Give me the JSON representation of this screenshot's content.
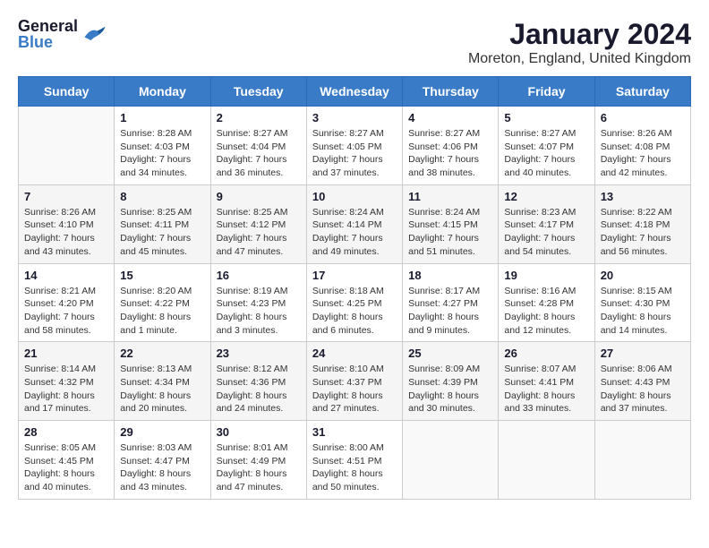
{
  "header": {
    "logo": {
      "general": "General",
      "blue": "Blue"
    },
    "title": "January 2024",
    "location": "Moreton, England, United Kingdom"
  },
  "calendar": {
    "days_of_week": [
      "Sunday",
      "Monday",
      "Tuesday",
      "Wednesday",
      "Thursday",
      "Friday",
      "Saturday"
    ],
    "weeks": [
      [
        {
          "date": "",
          "info": ""
        },
        {
          "date": "1",
          "info": "Sunrise: 8:28 AM\nSunset: 4:03 PM\nDaylight: 7 hours\nand 34 minutes."
        },
        {
          "date": "2",
          "info": "Sunrise: 8:27 AM\nSunset: 4:04 PM\nDaylight: 7 hours\nand 36 minutes."
        },
        {
          "date": "3",
          "info": "Sunrise: 8:27 AM\nSunset: 4:05 PM\nDaylight: 7 hours\nand 37 minutes."
        },
        {
          "date": "4",
          "info": "Sunrise: 8:27 AM\nSunset: 4:06 PM\nDaylight: 7 hours\nand 38 minutes."
        },
        {
          "date": "5",
          "info": "Sunrise: 8:27 AM\nSunset: 4:07 PM\nDaylight: 7 hours\nand 40 minutes."
        },
        {
          "date": "6",
          "info": "Sunrise: 8:26 AM\nSunset: 4:08 PM\nDaylight: 7 hours\nand 42 minutes."
        }
      ],
      [
        {
          "date": "7",
          "info": "Sunrise: 8:26 AM\nSunset: 4:10 PM\nDaylight: 7 hours\nand 43 minutes."
        },
        {
          "date": "8",
          "info": "Sunrise: 8:25 AM\nSunset: 4:11 PM\nDaylight: 7 hours\nand 45 minutes."
        },
        {
          "date": "9",
          "info": "Sunrise: 8:25 AM\nSunset: 4:12 PM\nDaylight: 7 hours\nand 47 minutes."
        },
        {
          "date": "10",
          "info": "Sunrise: 8:24 AM\nSunset: 4:14 PM\nDaylight: 7 hours\nand 49 minutes."
        },
        {
          "date": "11",
          "info": "Sunrise: 8:24 AM\nSunset: 4:15 PM\nDaylight: 7 hours\nand 51 minutes."
        },
        {
          "date": "12",
          "info": "Sunrise: 8:23 AM\nSunset: 4:17 PM\nDaylight: 7 hours\nand 54 minutes."
        },
        {
          "date": "13",
          "info": "Sunrise: 8:22 AM\nSunset: 4:18 PM\nDaylight: 7 hours\nand 56 minutes."
        }
      ],
      [
        {
          "date": "14",
          "info": "Sunrise: 8:21 AM\nSunset: 4:20 PM\nDaylight: 7 hours\nand 58 minutes."
        },
        {
          "date": "15",
          "info": "Sunrise: 8:20 AM\nSunset: 4:22 PM\nDaylight: 8 hours\nand 1 minute."
        },
        {
          "date": "16",
          "info": "Sunrise: 8:19 AM\nSunset: 4:23 PM\nDaylight: 8 hours\nand 3 minutes."
        },
        {
          "date": "17",
          "info": "Sunrise: 8:18 AM\nSunset: 4:25 PM\nDaylight: 8 hours\nand 6 minutes."
        },
        {
          "date": "18",
          "info": "Sunrise: 8:17 AM\nSunset: 4:27 PM\nDaylight: 8 hours\nand 9 minutes."
        },
        {
          "date": "19",
          "info": "Sunrise: 8:16 AM\nSunset: 4:28 PM\nDaylight: 8 hours\nand 12 minutes."
        },
        {
          "date": "20",
          "info": "Sunrise: 8:15 AM\nSunset: 4:30 PM\nDaylight: 8 hours\nand 14 minutes."
        }
      ],
      [
        {
          "date": "21",
          "info": "Sunrise: 8:14 AM\nSunset: 4:32 PM\nDaylight: 8 hours\nand 17 minutes."
        },
        {
          "date": "22",
          "info": "Sunrise: 8:13 AM\nSunset: 4:34 PM\nDaylight: 8 hours\nand 20 minutes."
        },
        {
          "date": "23",
          "info": "Sunrise: 8:12 AM\nSunset: 4:36 PM\nDaylight: 8 hours\nand 24 minutes."
        },
        {
          "date": "24",
          "info": "Sunrise: 8:10 AM\nSunset: 4:37 PM\nDaylight: 8 hours\nand 27 minutes."
        },
        {
          "date": "25",
          "info": "Sunrise: 8:09 AM\nSunset: 4:39 PM\nDaylight: 8 hours\nand 30 minutes."
        },
        {
          "date": "26",
          "info": "Sunrise: 8:07 AM\nSunset: 4:41 PM\nDaylight: 8 hours\nand 33 minutes."
        },
        {
          "date": "27",
          "info": "Sunrise: 8:06 AM\nSunset: 4:43 PM\nDaylight: 8 hours\nand 37 minutes."
        }
      ],
      [
        {
          "date": "28",
          "info": "Sunrise: 8:05 AM\nSunset: 4:45 PM\nDaylight: 8 hours\nand 40 minutes."
        },
        {
          "date": "29",
          "info": "Sunrise: 8:03 AM\nSunset: 4:47 PM\nDaylight: 8 hours\nand 43 minutes."
        },
        {
          "date": "30",
          "info": "Sunrise: 8:01 AM\nSunset: 4:49 PM\nDaylight: 8 hours\nand 47 minutes."
        },
        {
          "date": "31",
          "info": "Sunrise: 8:00 AM\nSunset: 4:51 PM\nDaylight: 8 hours\nand 50 minutes."
        },
        {
          "date": "",
          "info": ""
        },
        {
          "date": "",
          "info": ""
        },
        {
          "date": "",
          "info": ""
        }
      ]
    ]
  }
}
